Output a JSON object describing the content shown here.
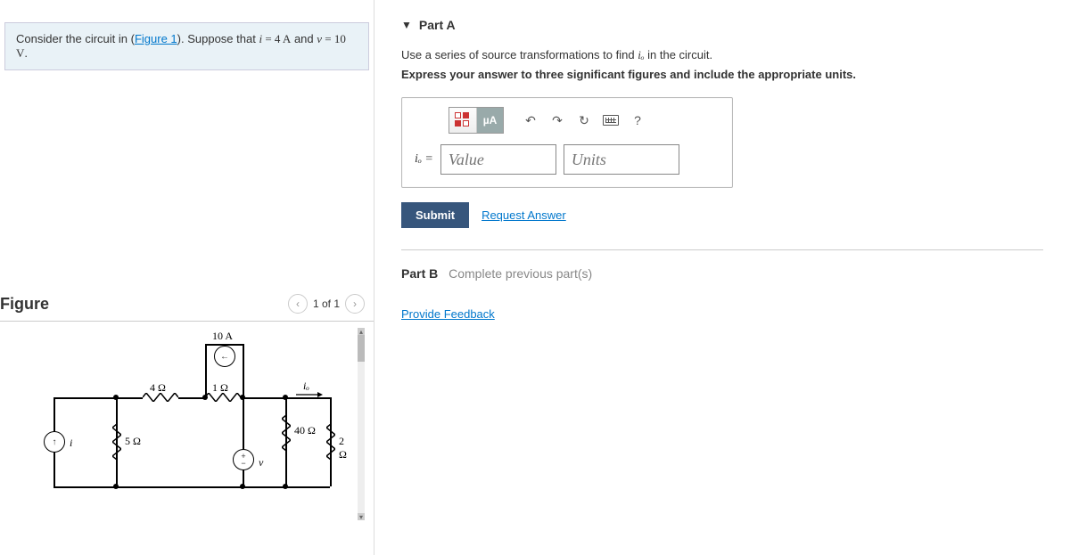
{
  "prompt": {
    "prefix": "Consider the circuit in (",
    "figure_link": "Figure 1",
    "middle": "). Suppose that ",
    "var1": "i",
    "eq1": " = 4 A",
    "and": " and ",
    "var2": "v",
    "eq2": " = 10 V",
    "suffix": "."
  },
  "figure": {
    "title": "Figure",
    "pager": "1 of 1",
    "labels": {
      "i_src": "i",
      "r5": "5 Ω",
      "r4": "4 Ω",
      "r1": "1 Ω",
      "i10a": "10 A",
      "r40": "40 Ω",
      "v_src": "v",
      "r2": "2 Ω",
      "io": "iₒ"
    }
  },
  "partA": {
    "title": "Part A",
    "instr1_a": "Use a series of source transformations to find ",
    "instr1_var": "iₒ",
    "instr1_b": " in the circuit.",
    "instr2": "Express your answer to three significant figures and include the appropriate units.",
    "eq_label": "iₒ =",
    "value_placeholder": "Value",
    "units_placeholder": "Units",
    "toolbar_units": "µA",
    "submit": "Submit",
    "request": "Request Answer"
  },
  "partB": {
    "label": "Part B",
    "status": "Complete previous part(s)"
  },
  "feedback_link": "Provide Feedback",
  "help_label": "?"
}
